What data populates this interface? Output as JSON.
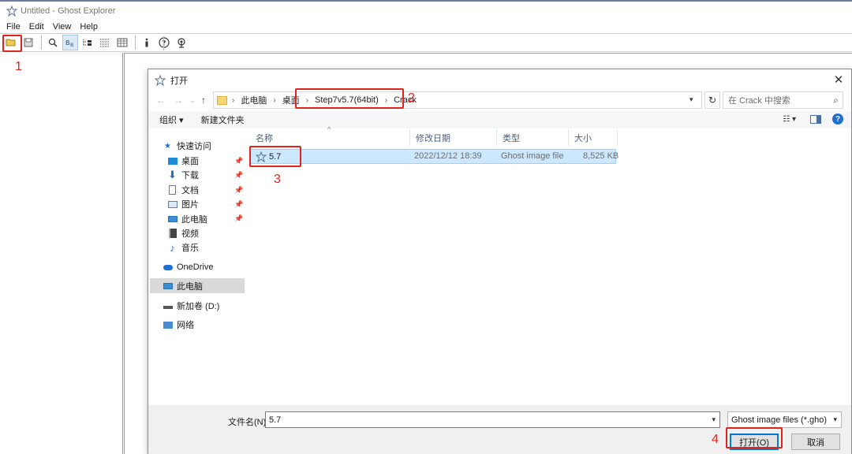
{
  "app": {
    "title": "Untitled - Ghost Explorer",
    "menu": [
      "File",
      "Edit",
      "View",
      "Help"
    ],
    "toolbar_icons": [
      "open-folder-icon",
      "save-icon",
      "find-icon",
      "details-icon",
      "tree-icon",
      "list-icon",
      "info-icon",
      "help-icon",
      "about-icon"
    ]
  },
  "dialog": {
    "title": "打开",
    "breadcrumb": [
      "此电脑",
      "桌面",
      "Step7v5.7(64bit)",
      "Crack"
    ],
    "search_placeholder": "在 Crack 中搜索",
    "commands": {
      "organize": "组织 ▾",
      "new_folder": "新建文件夹"
    },
    "nav": {
      "quick_access": "快速访问",
      "items": [
        "桌面",
        "下载",
        "文档",
        "图片",
        "此电脑",
        "视频",
        "音乐"
      ],
      "onedrive": "OneDrive",
      "this_pc": "此电脑",
      "drive": "新加卷 (D:)",
      "network": "网络"
    },
    "columns": {
      "name": "名称",
      "modified": "修改日期",
      "type": "类型",
      "size": "大小"
    },
    "files": [
      {
        "name": "5.7",
        "modified": "2022/12/12 18:39",
        "type": "Ghost image file",
        "size": "8,525 KB"
      }
    ],
    "filename_label": "文件名(N):",
    "filename_value": "5.7",
    "filetype": "Ghost image files (*.gho)",
    "open_button": "打开(O)",
    "cancel_button": "取消"
  },
  "annotations": [
    "1",
    "2",
    "3",
    "4"
  ],
  "colors": {
    "annotation": "#e1231e",
    "selection": "#cce8ff",
    "accent": "#0078d7"
  }
}
